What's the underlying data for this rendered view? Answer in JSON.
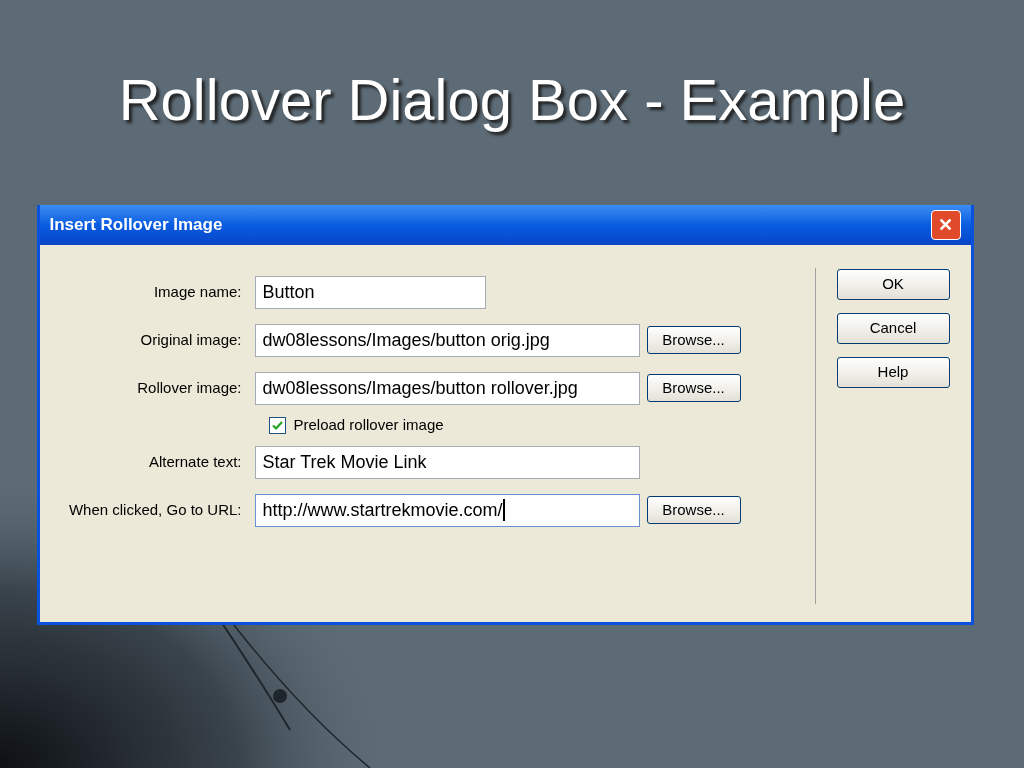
{
  "slide": {
    "title": "Rollover Dialog Box - Example"
  },
  "dialog": {
    "title": "Insert Rollover Image",
    "close": "✕",
    "rows": [
      {
        "kind": "short-field",
        "label": "Image name:",
        "value": "Button",
        "focused": false
      },
      {
        "kind": "field",
        "label": "Original image:",
        "value": "dw08lessons/Images/button orig.jpg",
        "focused": false,
        "browse": "Browse..."
      },
      {
        "kind": "field",
        "label": "Rollover image:",
        "value": "dw08lessons/Images/button rollover.jpg",
        "focused": false,
        "browse": "Browse..."
      },
      {
        "kind": "checkbox",
        "label": "Preload rollover image",
        "checked": true
      },
      {
        "kind": "field",
        "label": "Alternate text:",
        "value": "Star Trek Movie Link",
        "focused": false
      },
      {
        "kind": "field",
        "label": "When clicked, Go to URL:",
        "value": "http://www.startrekmovie.com/",
        "focused": true,
        "browse": "Browse..."
      }
    ],
    "buttons": [
      "OK",
      "Cancel",
      "Help"
    ]
  }
}
